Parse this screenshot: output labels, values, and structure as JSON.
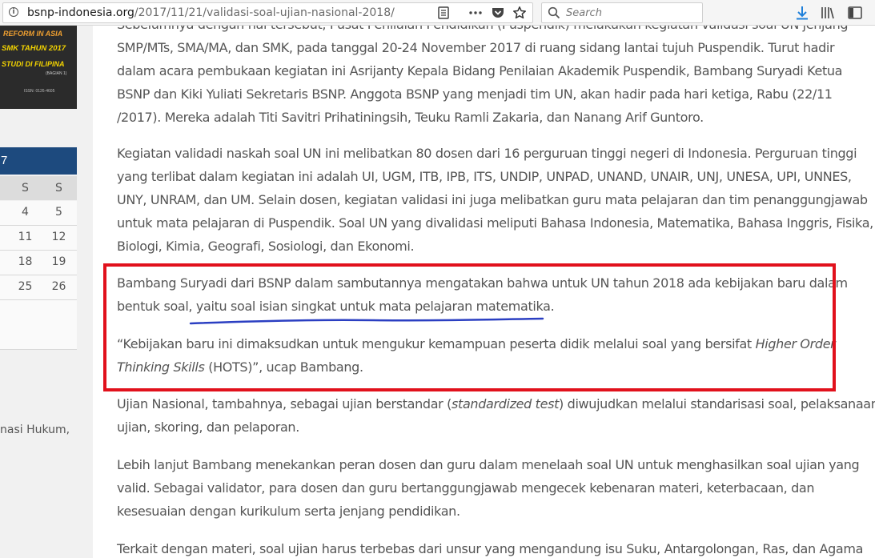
{
  "browser": {
    "url_host": "bsnp-indonesia.org",
    "url_path": "/2017/11/21/validasi-soal-ujian-nasional-2018/",
    "search_placeholder": "Search",
    "icons": [
      "info-icon",
      "reader-view-icon",
      "more-actions-icon",
      "pocket-icon",
      "bookmark-star-icon",
      "search-icon",
      "download-icon",
      "library-icon",
      "sidebar-toggle-icon"
    ]
  },
  "sidebar": {
    "banner": {
      "line1": "REFORM IN ASIA",
      "line2": "SMK TAHUN 2017",
      "line3": "STUDI DI FILIPINA",
      "line4": "(BAGIAN 1)",
      "line5": "ISSN: 0126-4605"
    },
    "calendar": {
      "header": "7",
      "days": [
        "S",
        "S"
      ],
      "rows": [
        [
          "4",
          "5"
        ],
        [
          "11",
          "12"
        ],
        [
          "18",
          "19"
        ],
        [
          "25",
          "26"
        ]
      ]
    },
    "link_text": "nasi Hukum,"
  },
  "article": {
    "p1": {
      "lines": [
        "Sebelumnya dengan hal tersebut, Pusat Penilaian Pendidikan (Puspendik) melakukan kegiatan validasi soal UN jenjang",
        "SMP/MTs, SMA/MA, dan SMK, pada tanggal 20-24 November 2017 di ruang sidang lantai tujuh Puspendik. Turut hadir",
        "dalam acara pembukaan kegiatan ini Asrijanty  Kepala Bidang Penilaian Akademik Puspendik, Bambang Suryadi Ketua",
        "BSNP dan Kiki Yuliati Sekretaris BSNP. Anggota BSNP yang menjadi tim UN, akan hadir pada hari ketiga, Rabu (22/11",
        "/2017). Mereka adalah Titi Savitri Prihatiningsih, Teuku Ramli Zakaria, dan Nanang Arif Guntoro."
      ]
    },
    "p2": {
      "lines": [
        "Kegiatan validadi naskah soal UN ini melibatkan 80 dosen dari 16 perguruan tinggi negeri di Indonesia. Perguruan tinggi",
        "yang terlibat dalam kegiatan ini adalah UI, UGM, ITB, IPB, ITS, UNDIP, UNPAD, UNAND, UNAIR, UNJ, UNESA, UPI, UNNES,",
        "UNY, UNRAM, dan UM. Selain dosen, kegiatan validasi ini juga melibatkan guru mata pelajaran dan tim penanggungjawab",
        "untuk mata pelajaran di Puspendik. Soal UN yang divalidasi meliputi Bahasa Indonesia, Matematika, Bahasa Inggris, Fisika,",
        "Biologi, Kimia, Geografi, Sosiologi, dan Ekonomi."
      ]
    },
    "p3": {
      "lines": [
        "Bambang Suryadi dari BSNP dalam sambutannya mengatakan bahwa untuk UN tahun 2018 ada kebijakan baru dalam",
        "bentuk soal, yaitu soal isian singkat untuk mata pelajaran matematika."
      ]
    },
    "p4": {
      "line1": "“Kebijakan baru ini dimaksudkan untuk mengukur kemampuan peserta didik melalui soal yang bersifat ",
      "line1_italic": "Higher Order",
      "line2_italic": "Thinking Skills",
      "line2_rest": " (HOTS)”, ucap Bambang."
    },
    "p5": {
      "line1_pre": "Ujian Nasional, tambahnya, sebagai ujian berstandar (",
      "line1_italic": "standardized test",
      "line1_post": ") diwujudkan melalui standarisasi soal, pelaksanaan",
      "line2": "ujian, skoring, dan pelaporan."
    },
    "p6": {
      "lines": [
        "Lebih lanjut Bambang menekankan peran dosen dan guru dalam menelaah soal UN untuk menghasilkan soal ujian yang",
        "valid. Sebagai validator, para dosen dan guru bertanggungjawab mengecek kebenaran materi, keterbacaan, dan",
        "kesesuaian dengan kurikulum serta jenjang pendidikan."
      ]
    },
    "p7": {
      "lines": [
        "Terkait dengan materi, soal ujian harus terbebas dari unsur yang mengandung isu Suku, Antargolongan, Ras, dan Agama"
      ]
    }
  },
  "annotation_colors": {
    "box": "#e1111c",
    "underline": "#2b3fc2"
  }
}
